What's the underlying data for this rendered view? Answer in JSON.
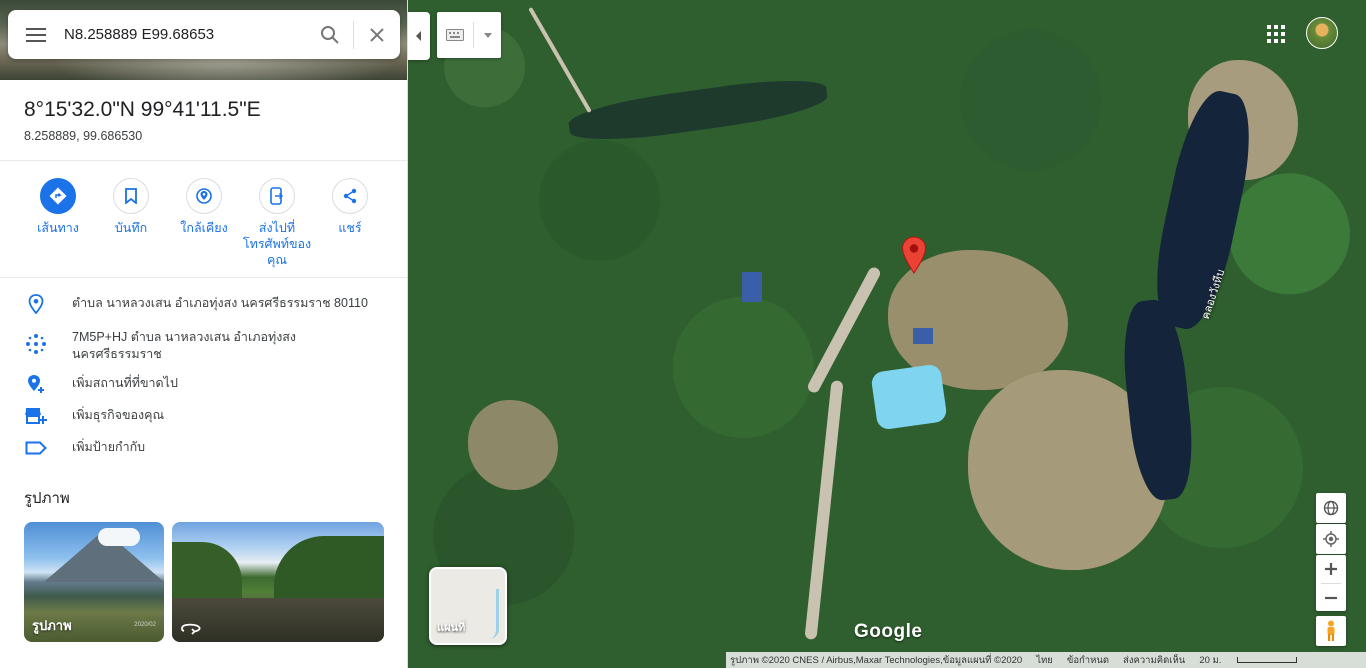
{
  "search": {
    "value": "N8.258889 E99.68653"
  },
  "place": {
    "title": "8°15'32.0\"N 99°41'11.5\"E",
    "subtitle": "8.258889, 99.686530"
  },
  "actions": [
    {
      "label": "เส้นทาง",
      "icon": "directions-icon"
    },
    {
      "label": "บันทึก",
      "icon": "bookmark-icon"
    },
    {
      "label": "ใกล้เคียง",
      "icon": "nearby-icon"
    },
    {
      "label": "ส่งไปที่โทรศัพท์ของคุณ",
      "icon": "send-to-phone-icon"
    },
    {
      "label": "แชร์",
      "icon": "share-icon"
    }
  ],
  "info": [
    {
      "text": "ตำบล นาหลวงเสน อำเภอทุ่งสง นครศรีธรรมราช 80110",
      "icon": "location-pin-icon"
    },
    {
      "text": "7M5P+HJ ตำบล นาหลวงเสน อำเภอทุ่งสง นครศรีธรรมราช",
      "icon": "plus-code-icon"
    },
    {
      "text": "เพิ่มสถานที่ที่ขาดไป",
      "icon": "add-place-icon"
    },
    {
      "text": "เพิ่มธุรกิจของคุณ",
      "icon": "add-business-icon"
    },
    {
      "text": "เพิ่มป้ายกำกับ",
      "icon": "label-icon"
    }
  ],
  "photos": {
    "title": "รูปภาพ",
    "items": [
      {
        "label": "รูปภาพ",
        "stamp": "2020/02"
      },
      {
        "label": "",
        "icon": "panorama-icon"
      }
    ]
  },
  "map": {
    "layer_label": "แผนที่",
    "logo": "Google",
    "river_label": "คลองวังหีบ",
    "attribution": "รูปภาพ ©2020 CNES / Airbus,Maxar Technologies,ข้อมูลแผนที่ ©2020",
    "language": "ไทย",
    "terms": "ข้อกำหนด",
    "feedback": "ส่งความคิดเห็น",
    "scale": "20 ม."
  },
  "colors": {
    "accent": "#1a73e8",
    "pin": "#ea4335"
  }
}
